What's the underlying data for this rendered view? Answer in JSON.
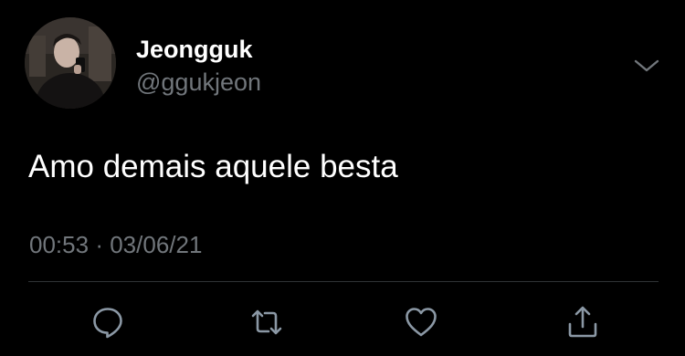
{
  "tweet": {
    "author": {
      "display_name": "Jeongguk",
      "handle": "@ggukjeon",
      "avatar_icon": "user-avatar-photo"
    },
    "text": "Amo demais aquele besta",
    "time": "00:53",
    "separator": "·",
    "date": "03/06/21"
  },
  "actions": [
    {
      "name": "reply",
      "icon": "speech-bubble-icon"
    },
    {
      "name": "retweet",
      "icon": "retweet-arrows-icon"
    },
    {
      "name": "like",
      "icon": "heart-icon"
    },
    {
      "name": "share",
      "icon": "share-upload-icon"
    }
  ],
  "menu": {
    "icon": "chevron-down-icon"
  },
  "colors": {
    "background": "#000000",
    "primary_text": "#ffffff",
    "secondary_text": "#71767b",
    "divider": "#2f3336",
    "icon": "#8b98a5"
  }
}
